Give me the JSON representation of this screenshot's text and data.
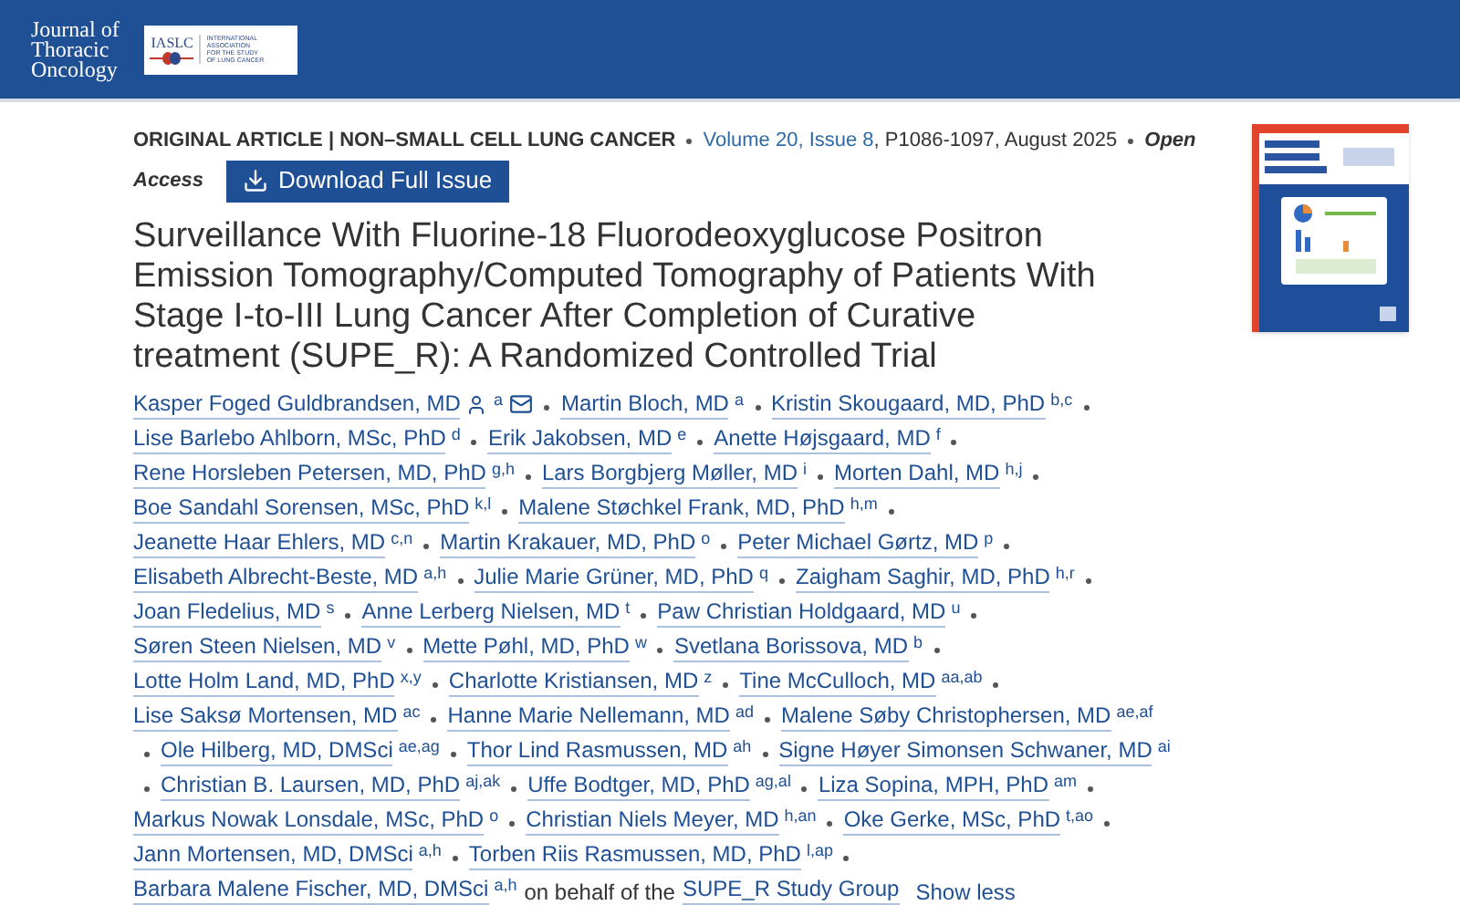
{
  "header": {
    "journal_name": [
      "Journal of",
      "Thoracic",
      "Oncology"
    ],
    "society_abbr": "IASLC",
    "society_name": [
      "INTERNATIONAL",
      "ASSOCIATION",
      "FOR THE STUDY",
      "OF LUNG CANCER"
    ]
  },
  "meta": {
    "section": "ORIGINAL ARTICLE | NON–SMALL CELL LUNG CANCER",
    "volume_issue": "Volume 20, Issue 8",
    "pages_date": ", P1086-1097, August 2025",
    "access_first": "Open",
    "access_second": "Access"
  },
  "download_button": "Download Full Issue",
  "title": "Surveillance With Fluorine-18 Fluorodeoxyglucose Positron Emission Tomography/Computed Tomography of Patients With Stage I-to-III Lung Cancer After Completion of Curative treatment (SUPE_R): A Randomized Controlled Trial",
  "author_lines": [
    {
      "leading_separator": false,
      "trailing_separator": true,
      "authors": [
        {
          "name": "Kasper Foged Guldbrandsen, MD",
          "sup": "a",
          "profile": true,
          "email": true
        },
        {
          "name": "Martin Bloch, MD",
          "sup": "a"
        },
        {
          "name": "Kristin Skougaard, MD, PhD",
          "sup": "b,c"
        }
      ]
    },
    {
      "leading_separator": false,
      "trailing_separator": true,
      "authors": [
        {
          "name": "Lise Barlebo Ahlborn, MSc, PhD",
          "sup": "d"
        },
        {
          "name": "Erik Jakobsen, MD",
          "sup": "e"
        },
        {
          "name": "Anette Højsgaard, MD",
          "sup": "f"
        }
      ]
    },
    {
      "leading_separator": false,
      "trailing_separator": true,
      "authors": [
        {
          "name": "Rene Horsleben Petersen, MD, PhD",
          "sup": "g,h"
        },
        {
          "name": "Lars Borgbjerg Møller, MD",
          "sup": "i"
        },
        {
          "name": "Morten Dahl, MD",
          "sup": "h,j"
        }
      ]
    },
    {
      "leading_separator": false,
      "trailing_separator": true,
      "authors": [
        {
          "name": "Boe Sandahl Sorensen, MSc, PhD",
          "sup": "k,l"
        },
        {
          "name": "Malene Støchkel Frank, MD, PhD",
          "sup": "h,m"
        }
      ]
    },
    {
      "leading_separator": false,
      "trailing_separator": true,
      "authors": [
        {
          "name": "Jeanette Haar Ehlers, MD",
          "sup": "c,n"
        },
        {
          "name": "Martin Krakauer, MD, PhD",
          "sup": "o"
        },
        {
          "name": "Peter Michael Gørtz, MD",
          "sup": "p"
        }
      ]
    },
    {
      "leading_separator": false,
      "trailing_separator": true,
      "authors": [
        {
          "name": "Elisabeth Albrecht-Beste, MD",
          "sup": "a,h"
        },
        {
          "name": "Julie Marie Grüner, MD, PhD",
          "sup": "q"
        },
        {
          "name": "Zaigham Saghir, MD, PhD",
          "sup": "h,r"
        }
      ]
    },
    {
      "leading_separator": false,
      "trailing_separator": true,
      "authors": [
        {
          "name": "Joan Fledelius, MD",
          "sup": "s"
        },
        {
          "name": "Anne Lerberg Nielsen, MD",
          "sup": "t"
        },
        {
          "name": "Paw Christian Holdgaard, MD",
          "sup": "u"
        }
      ]
    },
    {
      "leading_separator": false,
      "trailing_separator": true,
      "authors": [
        {
          "name": "Søren Steen Nielsen, MD",
          "sup": "v"
        },
        {
          "name": "Mette Pøhl, MD, PhD",
          "sup": "w"
        },
        {
          "name": "Svetlana Borissova, MD",
          "sup": "b"
        }
      ]
    },
    {
      "leading_separator": false,
      "trailing_separator": true,
      "authors": [
        {
          "name": "Lotte Holm Land, MD, PhD",
          "sup": "x,y"
        },
        {
          "name": "Charlotte Kristiansen, MD",
          "sup": "z"
        },
        {
          "name": "Tine McCulloch, MD",
          "sup": "aa,ab"
        }
      ]
    },
    {
      "leading_separator": false,
      "trailing_separator": false,
      "authors": [
        {
          "name": "Lise Saksø Mortensen, MD",
          "sup": "ac"
        },
        {
          "name": "Hanne Marie Nellemann, MD",
          "sup": "ad"
        },
        {
          "name": "Malene Søby Christophersen, MD",
          "sup": "ae,af"
        }
      ]
    },
    {
      "leading_separator": true,
      "trailing_separator": false,
      "authors": [
        {
          "name": "Ole Hilberg, MD, DMSci",
          "sup": "ae,ag"
        },
        {
          "name": "Thor Lind Rasmussen, MD",
          "sup": "ah"
        },
        {
          "name": "Signe Høyer Simonsen Schwaner, MD",
          "sup": "ai"
        }
      ]
    },
    {
      "leading_separator": true,
      "trailing_separator": true,
      "authors": [
        {
          "name": "Christian B. Laursen, MD, PhD",
          "sup": "aj,ak"
        },
        {
          "name": "Uffe Bodtger, MD, PhD",
          "sup": "ag,al"
        },
        {
          "name": "Liza Sopina, MPH, PhD",
          "sup": "am"
        }
      ]
    },
    {
      "leading_separator": false,
      "trailing_separator": true,
      "authors": [
        {
          "name": "Markus Nowak Lonsdale, MSc, PhD",
          "sup": "o"
        },
        {
          "name": "Christian Niels Meyer, MD",
          "sup": "h,an"
        },
        {
          "name": "Oke Gerke, MSc, PhD",
          "sup": "t,ao"
        }
      ]
    },
    {
      "leading_separator": false,
      "trailing_separator": true,
      "authors": [
        {
          "name": "Jann Mortensen, MD, DMSci",
          "sup": "a,h"
        },
        {
          "name": "Torben Riis Rasmussen, MD, PhD",
          "sup": "l,ap"
        }
      ]
    },
    {
      "leading_separator": false,
      "trailing_separator": false,
      "authors": [
        {
          "name": "Barbara Malene Fischer, MD, DMSci",
          "sup": "a,h"
        }
      ]
    }
  ],
  "group_note": "on behalf of the",
  "group_link": "SUPE_R Study Group",
  "show_less": "Show less"
}
